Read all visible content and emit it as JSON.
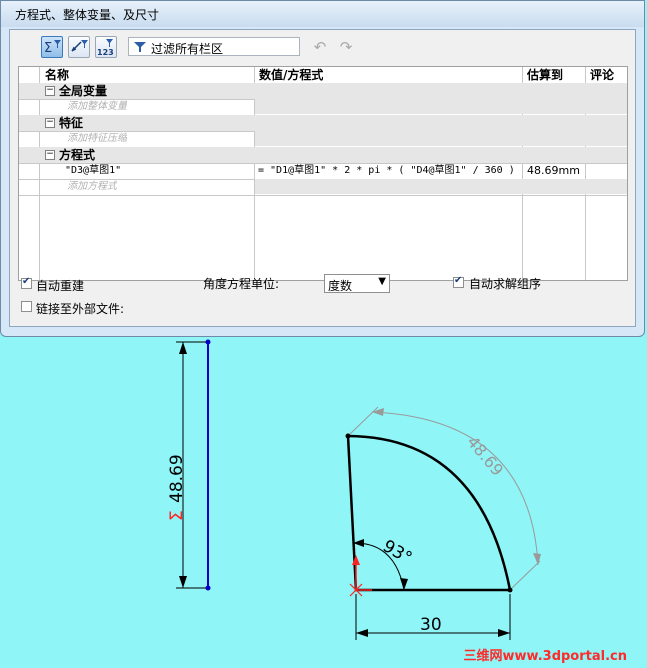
{
  "dialog": {
    "title": "方程式、整体变量、及尺寸",
    "filter_text": "过滤所有栏区",
    "toolbar": {
      "equation_view_icon": "sigma-filter-icon",
      "sketch_view_icon": "dimension-view-icon",
      "ordered_view_icon": "ordered-123-icon",
      "undo_icon": "undo-icon",
      "redo_icon": "redo-icon"
    },
    "columns": [
      "名称",
      "数值/方程式",
      "估算到",
      "评论"
    ],
    "sections": [
      {
        "label": "全局变量",
        "add_placeholder": "添加整体变量"
      },
      {
        "label": "特征",
        "add_placeholder": "添加特征压缩"
      },
      {
        "label": "方程式",
        "add_placeholder": "添加方程式"
      }
    ],
    "equation_row": {
      "name": "\"D3@草图1\"",
      "value": "= \"D1@草图1\" * 2 * pi * ( \"D4@草图1\" / 360 )",
      "evaluates_to": "48.69mm"
    },
    "options": {
      "auto_rebuild_label": "自动重建",
      "auto_rebuild_checked": true,
      "angle_unit_label": "角度方程单位:",
      "angle_unit_value": "度数",
      "auto_solve_label": "自动求解组序",
      "auto_solve_checked": true,
      "link_external_label": "链接至外部文件:",
      "link_external_checked": false
    }
  },
  "sketch": {
    "vertical_dim_label": "48.69",
    "equation_symbol": "Σ",
    "arc_dim_label": "48.69",
    "angle_dim_label": "93°",
    "base_dim_label": "30"
  },
  "watermark": "三维网www.3dportal.cn",
  "colors": {
    "background": "#8ff5f7",
    "line_blue": "#0000c8",
    "dim_grey": "#808080",
    "sigma_red": "#ff2222"
  }
}
